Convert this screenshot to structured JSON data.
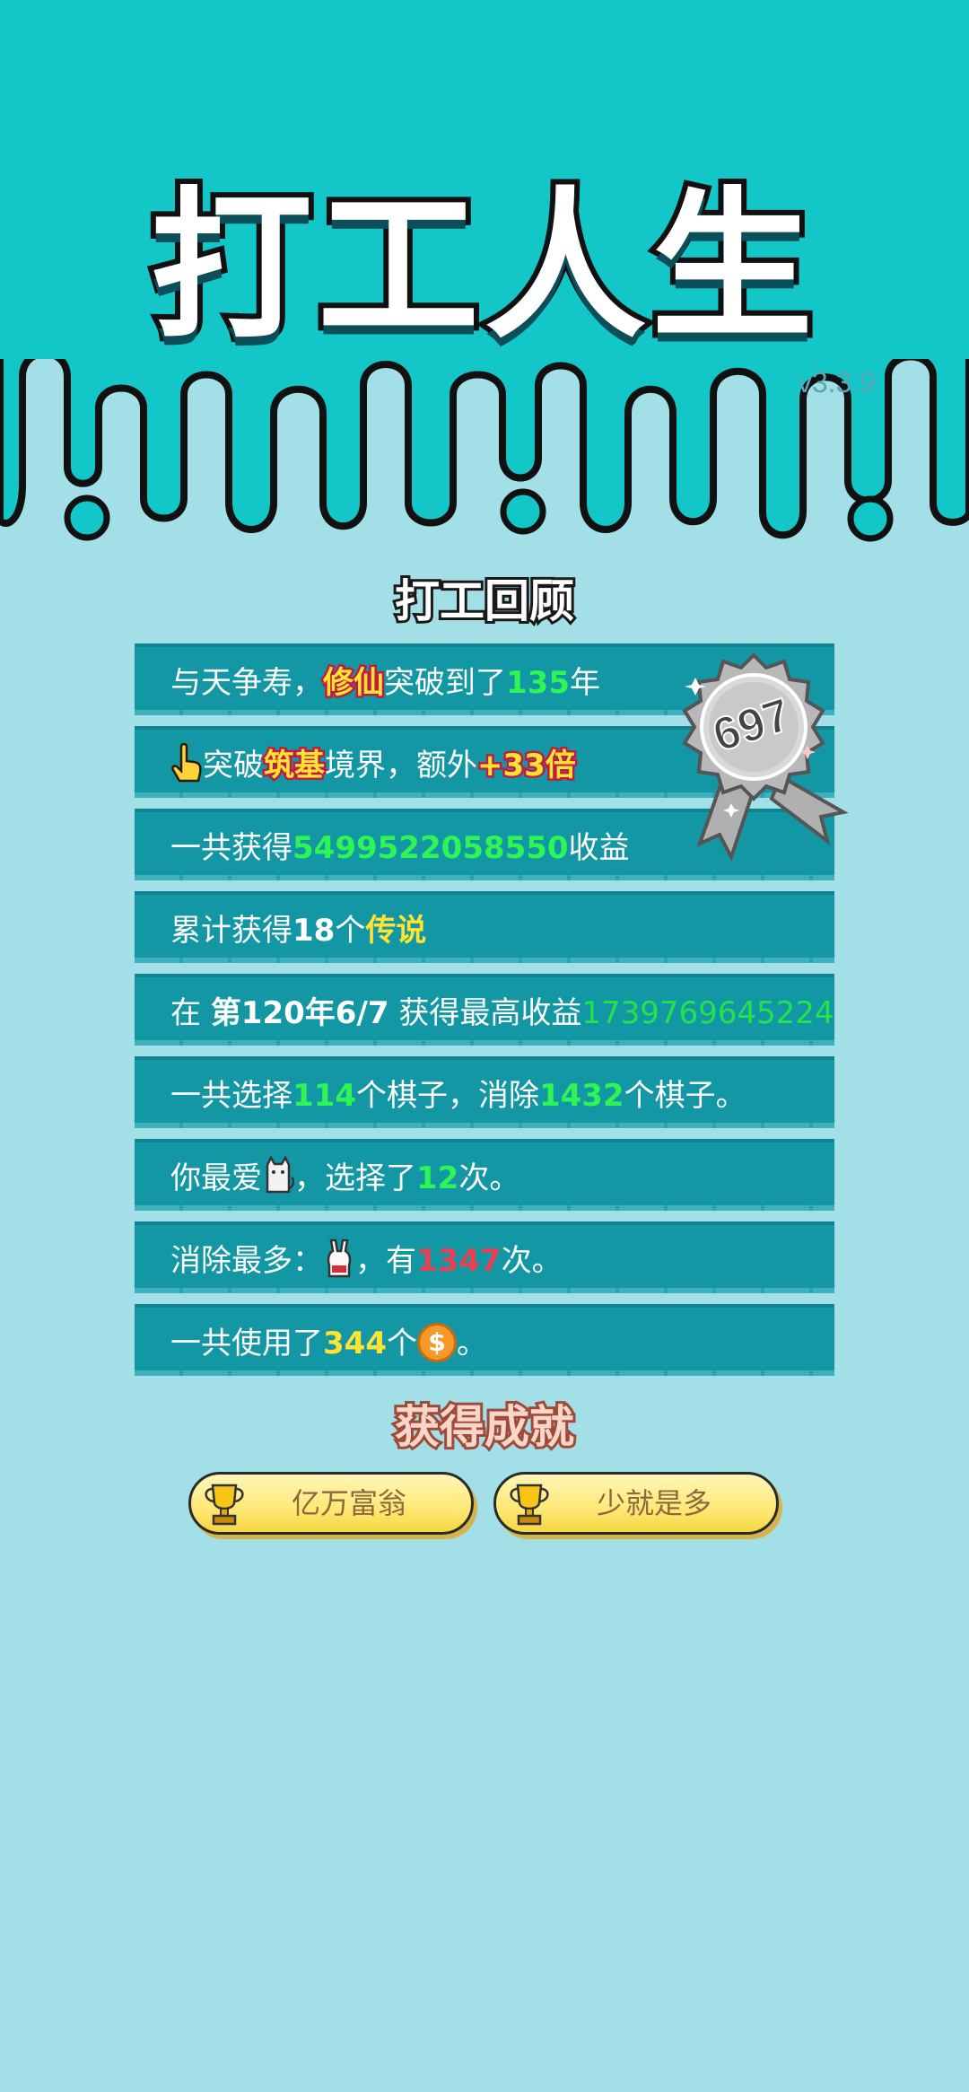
{
  "header": {
    "title": "打工人生",
    "version": "v3.3.9"
  },
  "review": {
    "title": "打工回顾",
    "badge_value": "697",
    "rows": [
      {
        "a": "与天争寿，",
        "b": "修仙",
        "c": "突破到了",
        "d": "135",
        "e": "年"
      },
      {
        "a": "突破",
        "b": "筑基",
        "c": "境界，额外",
        "d": "+33倍"
      },
      {
        "a": "一共获得",
        "b": "5499522058550",
        "c": "收益"
      },
      {
        "a": "累计获得",
        "b": "18",
        "c": "个",
        "d": "传说"
      },
      {
        "a": "在 ",
        "b": "第120年6/7",
        "c": " 获得最高收益",
        "d": "1739769645224"
      },
      {
        "a": "一共选择",
        "b": "114",
        "c": "个棋子，消除",
        "d": "1432",
        "e": "个棋子。"
      },
      {
        "a": "你最爱",
        "c": "，选择了",
        "d": "12",
        "e": "次。"
      },
      {
        "a": "消除最多：",
        "c": "，有",
        "d": "1347",
        "e": "次。"
      },
      {
        "a": "一共使用了",
        "b": "344",
        "c": "个",
        "e": "。",
        "coin": "$"
      }
    ]
  },
  "achievements": {
    "title": "获得成就",
    "items": [
      "亿万富翁",
      "少就是多"
    ]
  },
  "icons": {
    "pointer": "pointing-hand-icon",
    "favorite": "cat-icon",
    "most_eliminated": "rabbit-icon",
    "coin": "coin-icon",
    "badge": "award-badge-icon",
    "trophy": "trophy-icon"
  },
  "colors": {
    "background": "#a3dfe6",
    "header": "#13c6c8",
    "row": "#1397a5",
    "highlight_green": "#2ef553",
    "highlight_yellow": "#ffe333",
    "highlight_red": "#e84152"
  }
}
